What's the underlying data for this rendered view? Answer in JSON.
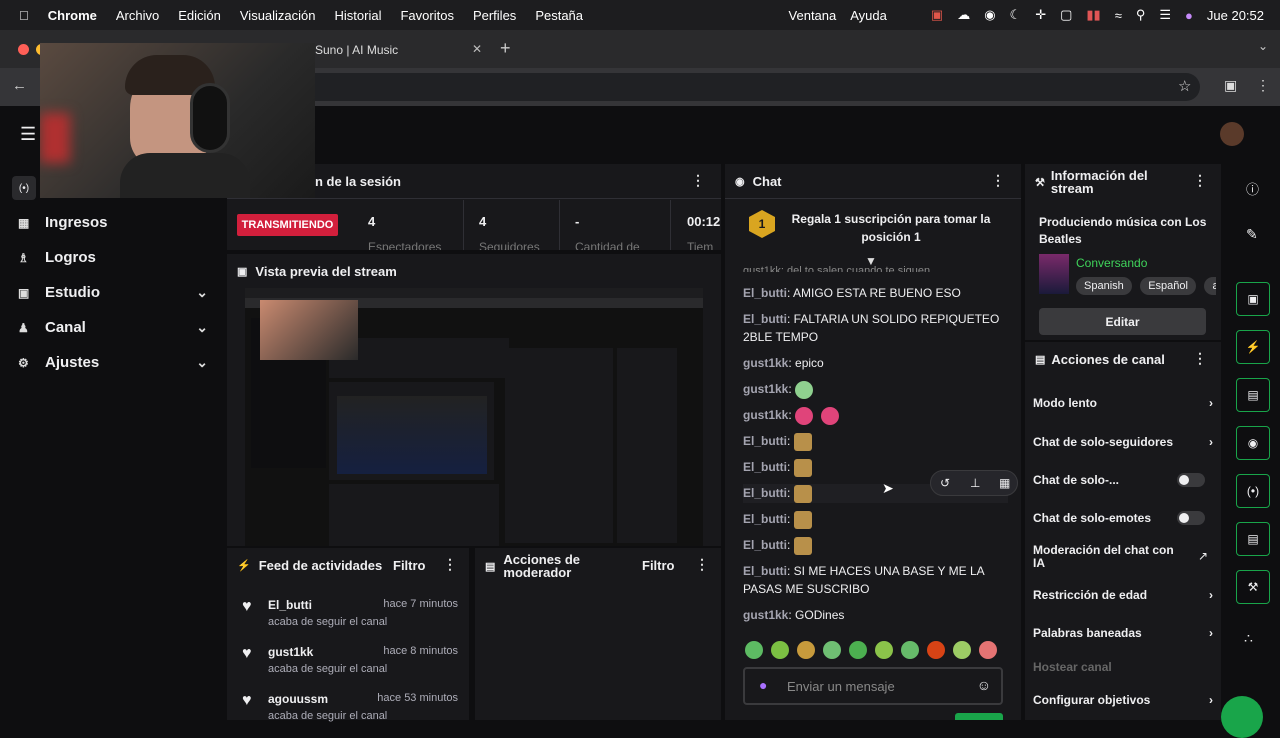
{
  "menubar": {
    "apple": "",
    "app": "Chrome",
    "items": [
      "Archivo",
      "Edición",
      "Visualización",
      "Historial",
      "Favoritos",
      "Perfiles",
      "Pestaña"
    ],
    "right_items": [
      "Ventana",
      "Ayuda"
    ],
    "clock": "Jue  20:52"
  },
  "browser": {
    "tab_title": "Suno | AI Music",
    "new_tab": "+"
  },
  "sidebar": {
    "items": [
      {
        "label": "Ingresos",
        "icon": "bars-icon"
      },
      {
        "label": "Logros",
        "icon": "trophy-icon"
      },
      {
        "label": "Estudio",
        "icon": "studio-icon",
        "expandable": true
      },
      {
        "label": "Canal",
        "icon": "users-icon",
        "expandable": true
      },
      {
        "label": "Ajustes",
        "icon": "gear-icon",
        "expandable": true
      }
    ]
  },
  "session": {
    "title": "n de la sesión",
    "live_badge": "TRANSMITIENDO",
    "stats": [
      {
        "value": "4",
        "label": "Espectadores"
      },
      {
        "value": "4",
        "label": "Seguidores"
      },
      {
        "value": "-",
        "label": "Cantidad de"
      },
      {
        "value": "00:12",
        "label": "Tiem"
      }
    ]
  },
  "preview": {
    "title": "Vista previa del stream"
  },
  "feed": {
    "title": "Feed de actividades",
    "filter": "Filtro",
    "items": [
      {
        "user": "El_butti",
        "time": "hace 7 minutos",
        "action": "acaba de seguir el canal"
      },
      {
        "user": "gust1kk",
        "time": "hace 8 minutos",
        "action": "acaba de seguir el canal"
      },
      {
        "user": "agouussm",
        "time": "hace 53 minutos",
        "action": "acaba de seguir el canal"
      }
    ]
  },
  "modactions": {
    "title": "Acciones de moderador",
    "filter": "Filtro"
  },
  "chat": {
    "title": "Chat",
    "pinned_rank": "1",
    "pinned_text": "Regala 1 suscripción para tomar la posición 1",
    "partial_line": "gust1kk: del to salen cuando te siguen",
    "messages": [
      {
        "user": "El_butti",
        "text": "AMIGO ESTA RE BUENO ESO"
      },
      {
        "user": "El_butti",
        "text": "FALTARIA UN SOLIDO REPIQUETEO 2BLE TEMPO"
      },
      {
        "user": "gust1kk",
        "text": "epico"
      },
      {
        "user": "gust1kk",
        "text": ""
      },
      {
        "user": "gust1kk",
        "text": ""
      },
      {
        "user": "El_butti",
        "text": ""
      },
      {
        "user": "El_butti",
        "text": ""
      },
      {
        "user": "El_butti",
        "text": ""
      },
      {
        "user": "El_butti",
        "text": ""
      },
      {
        "user": "El_butti",
        "text": ""
      },
      {
        "user": "El_butti",
        "text": "SI ME HACES UNA BASE Y ME LA PASAS ME SUSCRIBO"
      },
      {
        "user": "gust1kk",
        "text": "GODines"
      }
    ],
    "input_placeholder": "Enviar un mensaje",
    "emote_colors": [
      "#5dbb63",
      "#7bc043",
      "#c79a3c",
      "#6fbf73",
      "#4caf50",
      "#8bc34a",
      "#66bb6a",
      "#d84315",
      "#9ccc65",
      "#e57373"
    ]
  },
  "info": {
    "title": "Información del stream",
    "stream_title": "Produciendo música con Los Beatles",
    "category": "Conversando",
    "tags": [
      "Spanish",
      "Español",
      "a"
    ],
    "edit": "Editar"
  },
  "channel_actions": {
    "title": "Acciones de canal",
    "rows": [
      {
        "label": "Modo lento",
        "control": "chevron"
      },
      {
        "label": "Chat de solo-seguidores",
        "control": "chevron"
      },
      {
        "label": "Chat de solo-...",
        "control": "toggle"
      },
      {
        "label": "Chat de solo-emotes",
        "control": "toggle"
      },
      {
        "label": "Moderación del chat con IA",
        "control": "external"
      },
      {
        "label": "Restricción de edad",
        "control": "chevron"
      },
      {
        "label": "Palabras baneadas",
        "control": "chevron"
      },
      {
        "label": "Hostear canal",
        "control": "none"
      },
      {
        "label": "Configurar objetivos",
        "control": "chevron"
      }
    ]
  },
  "colors": {
    "live": "#d21f3c",
    "accent_green": "#19a54a",
    "category_green": "#3fd35a",
    "username": "#a4a4b0"
  }
}
